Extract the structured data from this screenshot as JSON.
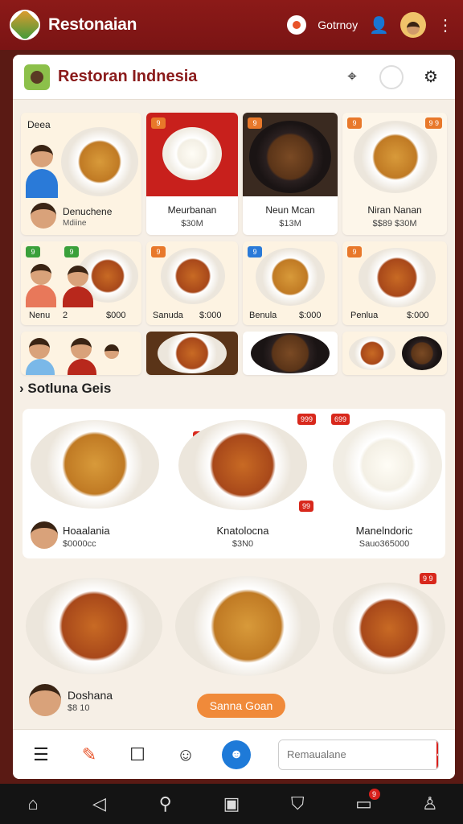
{
  "app": {
    "title": "Restonaian",
    "location_label": "Gotrnoy"
  },
  "header": {
    "title": "Restoran Indnesia"
  },
  "grid": {
    "row1": [
      {
        "label": "Denuchene",
        "sub": "Mdiine",
        "top_text": "Deea"
      },
      {
        "label": "Meurbanan",
        "sub": "$30M",
        "badge": "9"
      },
      {
        "label": "Neun Mcan",
        "sub": "$13M",
        "badge": "9"
      },
      {
        "label": "Niran Nanan",
        "sub": "$$89 $30M",
        "badge": "9",
        "badge2": "9 9"
      }
    ],
    "row2": [
      {
        "label": "Nenu",
        "sub": "$000",
        "num": "2",
        "badge": "9",
        "badge2": "9"
      },
      {
        "label": "Sanuda",
        "sub": "$:000",
        "badge": "9"
      },
      {
        "label": "Benula",
        "sub": "$:000",
        "badge": "9"
      },
      {
        "label": "Penlua",
        "sub": "$:000",
        "badge": "9"
      }
    ]
  },
  "section": {
    "title": "Sotluna Geis"
  },
  "featured": [
    {
      "label": "Hoaalania",
      "sub": "$0000cc"
    },
    {
      "label": "Knatolocna",
      "sub": "$3N0",
      "badge_a": "9",
      "badge_b": "999",
      "badge_c": "99",
      "badge_d": "699"
    },
    {
      "label": "Manelndoric",
      "sub": "Sauo365000"
    }
  ],
  "bottom_feature": {
    "label": "Doshana",
    "sub": "$8 10",
    "badge": "9 9"
  },
  "cta": {
    "label": "Sanna Goan"
  },
  "toolbar": {
    "search_placeholder": "Remaualane"
  },
  "navbar": {
    "badge": "9"
  }
}
